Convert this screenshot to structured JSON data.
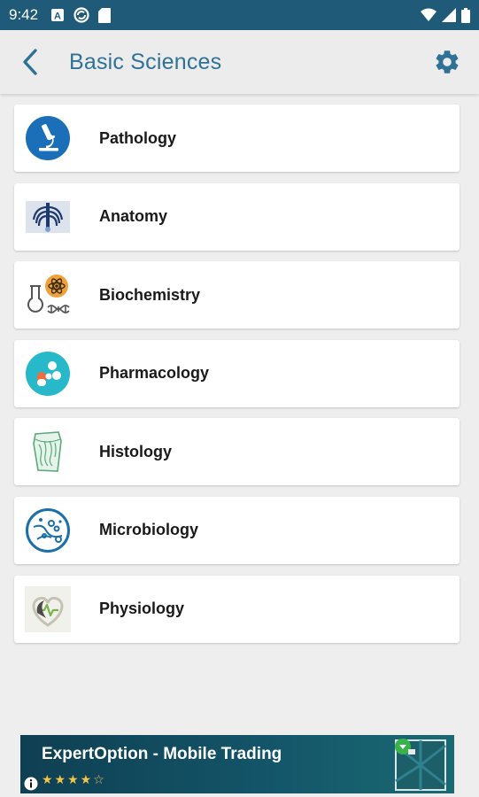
{
  "status_bar": {
    "time": "9:42",
    "icons": [
      "notification-a-icon",
      "sync-icon",
      "sd-card-icon",
      "wifi-icon",
      "signal-icon",
      "battery-icon"
    ]
  },
  "app_bar": {
    "title": "Basic Sciences",
    "back_icon": "back-arrow-icon",
    "settings_icon": "gear-icon"
  },
  "subjects": [
    {
      "label": "Pathology",
      "icon": "microscope-icon"
    },
    {
      "label": "Anatomy",
      "icon": "ribcage-icon"
    },
    {
      "label": "Biochemistry",
      "icon": "flask-atom-icon"
    },
    {
      "label": "Pharmacology",
      "icon": "pills-icon"
    },
    {
      "label": "Histology",
      "icon": "tissue-icon"
    },
    {
      "label": "Microbiology",
      "icon": "microbe-icon"
    },
    {
      "label": "Physiology",
      "icon": "heart-pulse-icon"
    }
  ],
  "ad": {
    "title": "ExpertOption - Mobile Trading",
    "rating_stars": 4.5,
    "stars_text": "★★★★☆"
  },
  "colors": {
    "status_bar": "#1f5b78",
    "accent": "#2f7296",
    "background": "#eeeeee"
  }
}
